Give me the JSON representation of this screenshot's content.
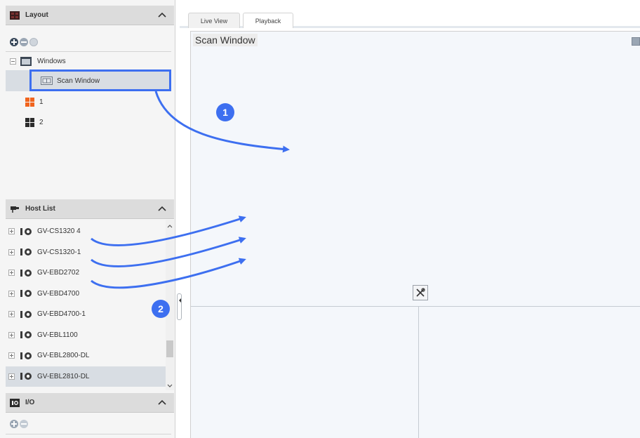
{
  "layout_section": {
    "title": "Layout",
    "tree": {
      "root_label": "Windows",
      "selected_child": "Scan Window",
      "items": [
        "1",
        "2"
      ]
    }
  },
  "host_section": {
    "title": "Host List",
    "hosts": [
      "GV-CS1320 4",
      "GV-CS1320-1",
      "GV-EBD2702",
      "GV-EBD4700",
      "GV-EBD4700-1",
      "GV-EBL1100",
      "GV-EBL2800-DL",
      "GV-EBL2810-DL"
    ],
    "selected_index": 7
  },
  "io_section": {
    "title": "I/O"
  },
  "tabs": {
    "live_view": "Live View",
    "playback": "Playback"
  },
  "viewer": {
    "title": "Scan Window"
  },
  "callouts": {
    "first": "1",
    "second": "2"
  },
  "colors": {
    "accent_blue": "#3d6ff0",
    "layout_icon_orange": "#f0641e",
    "layout_icon_dark": "#2c2c2c",
    "selection_border": "#3d6ff0",
    "viewer_bg": "#f4f7fb"
  },
  "icons": {
    "layout_section": "layout-grid-icon",
    "host_section": "camera-network-icon",
    "io_section": "io-icon",
    "settings": "tools-icon"
  }
}
